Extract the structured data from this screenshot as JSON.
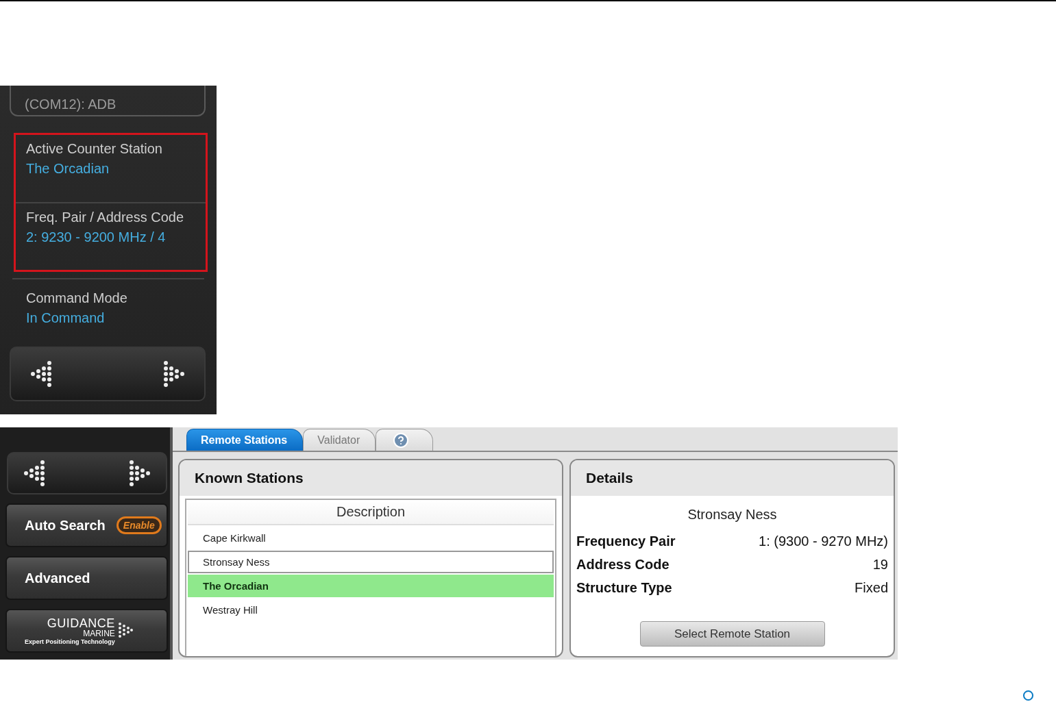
{
  "device_panel": {
    "port_label": "(COM12): ADB",
    "highlighted_fields": [
      {
        "label": "Active Counter Station",
        "value": "The Orcadian"
      },
      {
        "label": "Freq. Pair / Address Code",
        "value": "2: 9230 - 9200 MHz / 4"
      }
    ],
    "fields": [
      {
        "label": "Command Mode",
        "value": "In Command"
      }
    ]
  },
  "app": {
    "sidebar": {
      "buttons": [
        {
          "kind": "toggle",
          "label": "Auto Search",
          "badge": "Enable"
        },
        {
          "kind": "plain",
          "label": "Advanced"
        },
        {
          "kind": "logo",
          "label": "GUIDANCE",
          "sub": "MARINE",
          "tagline": "Expert Positioning Technology"
        }
      ]
    },
    "tabs": [
      {
        "kind": "text",
        "label": "Remote Stations",
        "selected": true
      },
      {
        "kind": "text",
        "label": "Validator",
        "selected": false
      },
      {
        "kind": "help",
        "selected": false
      }
    ],
    "known_stations": {
      "title": "Known Stations",
      "column": "Description",
      "rows": [
        {
          "label": "Cape Kirkwall",
          "selected": false,
          "focused": false
        },
        {
          "label": "Stronsay Ness",
          "selected": false,
          "focused": true
        },
        {
          "label": "The Orcadian",
          "selected": true,
          "focused": false
        },
        {
          "label": "Westray Hill",
          "selected": false,
          "focused": false
        }
      ]
    },
    "details": {
      "title": "Details",
      "station": "Stronsay Ness",
      "rows": [
        {
          "label": "Frequency Pair",
          "value": "1: (9300 - 9270 MHz)"
        },
        {
          "label": "Address Code",
          "value": "19"
        },
        {
          "label": "Structure Type",
          "value": "Fixed"
        }
      ],
      "button": "Select Remote Station"
    }
  }
}
